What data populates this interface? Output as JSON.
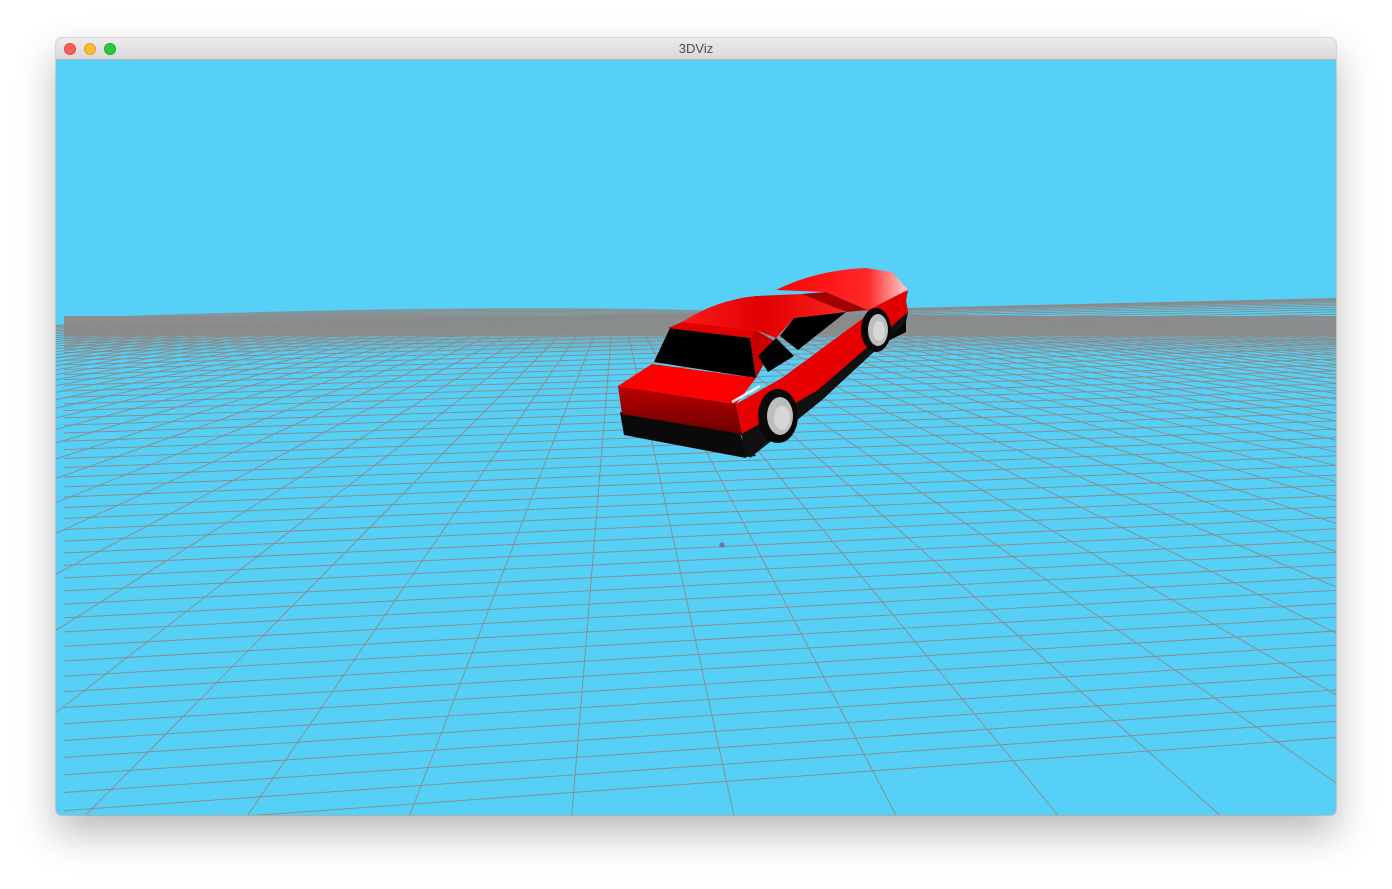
{
  "window": {
    "title": "3DViz",
    "controls": [
      "close",
      "minimize",
      "zoom"
    ]
  },
  "scene": {
    "sky_color": "#56d0f6",
    "ground_grid_color": "#8a8a8a",
    "horizon_haze_color": "#8c8c8c",
    "car_body_color": "#ff0000",
    "car_window_color": "#000000",
    "wheel_color": "#bdbdbd",
    "center_marker_color": "#7a6fa0"
  }
}
